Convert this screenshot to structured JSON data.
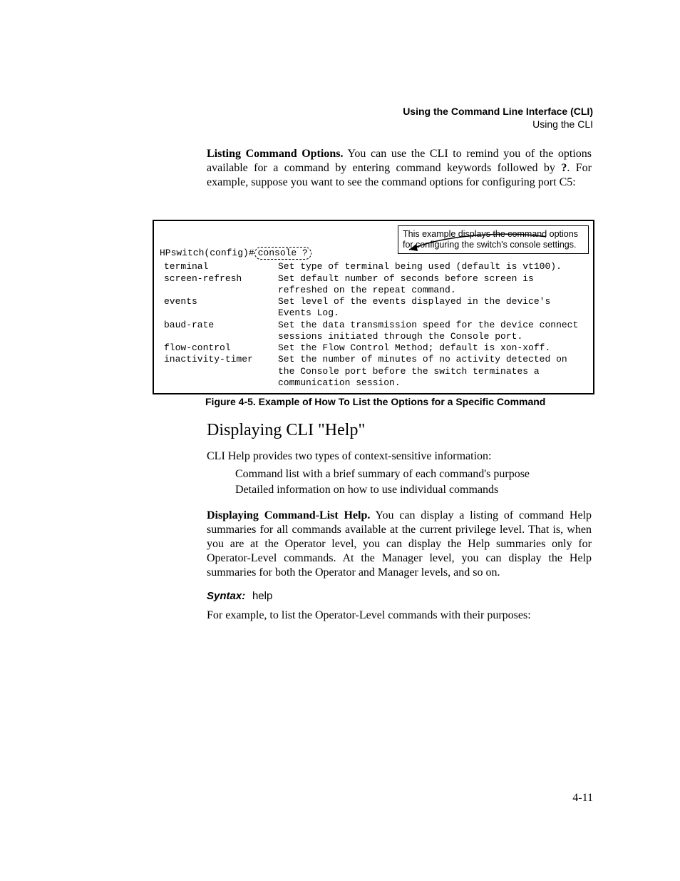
{
  "running_head": {
    "line1": "Using the Command Line Interface (CLI)",
    "line2": "Using the CLI"
  },
  "para1_runin": "Listing Command Options.",
  "para1_body": "  You can use the CLI to remind you of the options available for a command by entering command keywords followed by",
  "para1_qmark": "?",
  "para1_tail": ". For example, suppose you want to see the command options for config­uring port C5:",
  "figure": {
    "callout": "This example displays the command options for configuring the switch's console settings.",
    "prompt_prefix": "HPswitch(config)#",
    "prompt_boxed": " console ? ",
    "options": [
      {
        "k": "terminal",
        "d": "Set type of terminal being used (default is vt100)."
      },
      {
        "k": "screen-refresh",
        "d": "Set default number of seconds before screen is refreshed on the repeat command."
      },
      {
        "k": "events",
        "d": "Set level of the events displayed in the device's Events Log."
      },
      {
        "k": "baud-rate",
        "d": "Set the data transmission speed for the device connect sessions initiated through the Console port."
      },
      {
        "k": "flow-control",
        "d": "Set the Flow Control Method; default is xon-xoff."
      },
      {
        "k": "inactivity-timer",
        "d": "Set the number of minutes of no activity detected on the Console port before the switch terminates a communication session."
      }
    ],
    "caption": "Figure 4-5.   Example of How To List the Options for a Specific Command"
  },
  "h2": "Displaying CLI \"Help\"",
  "para2": "CLI Help provides two types of context-sensitive information:",
  "bullets": [
    "Command list with a brief summary of each command's purpose",
    "Detailed information on how to use individual commands"
  ],
  "para3_runin": "Displaying Command-List Help.",
  "para3_body": "  You can display a listing of command Help summaries for all commands available at the current privilege level. That is, when you are at the Operator level, you can display the Help summaries only for Operator-Level commands. At the Manager level, you can display the Help summaries for both the Operator  and Manager levels, and so on.",
  "syntax_label": "Syntax:",
  "syntax_cmd": "help",
  "para4": "For example, to list the Operator-Level commands with their purposes:",
  "page_number": "4-11"
}
